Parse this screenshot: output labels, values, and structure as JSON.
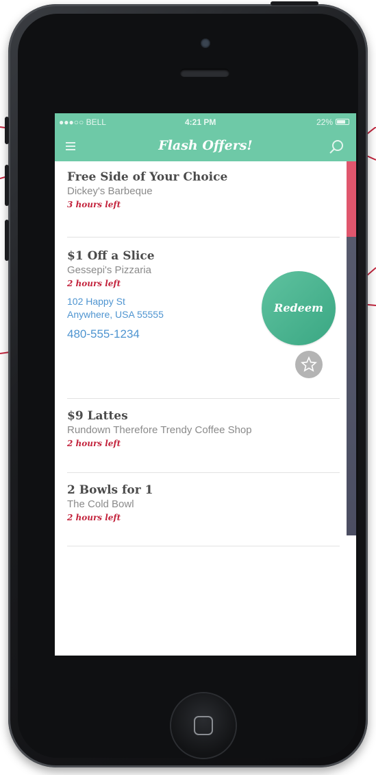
{
  "status_bar": {
    "carrier": "●●●○○ BELL",
    "time": "4:21 PM",
    "battery": "22%"
  },
  "nav": {
    "title": "Flash Offers!",
    "menu_icon": "hamburger-menu-icon",
    "search_icon": "search-icon"
  },
  "offers": [
    {
      "title": "Free Side of Your Choice",
      "vendor": "Dickey's Barbeque",
      "time_left": "3 hours left"
    },
    {
      "title": "$1 Off a Slice",
      "vendor": "Gessepi's Pizzaria",
      "time_left": "2 hours left",
      "address_line1": "102 Happy St",
      "address_line2": "Anywhere, USA 55555",
      "phone": "480-555-1234"
    },
    {
      "title": "$9 Lattes",
      "vendor": "Rundown Therefore Trendy Coffee Shop",
      "time_left": "2 hours left"
    },
    {
      "title": "2 Bowls for 1",
      "vendor": "The Cold Bowl",
      "time_left": "2 hours left"
    }
  ],
  "actions": {
    "redeem_label": "Redeem",
    "favorite_icon": "star-icon"
  },
  "colors": {
    "accent": "#6ec9a7",
    "redeem": "#4fb893",
    "time_left": "#c3243d",
    "link": "#4e94d0",
    "annotation": "#c3243d"
  }
}
